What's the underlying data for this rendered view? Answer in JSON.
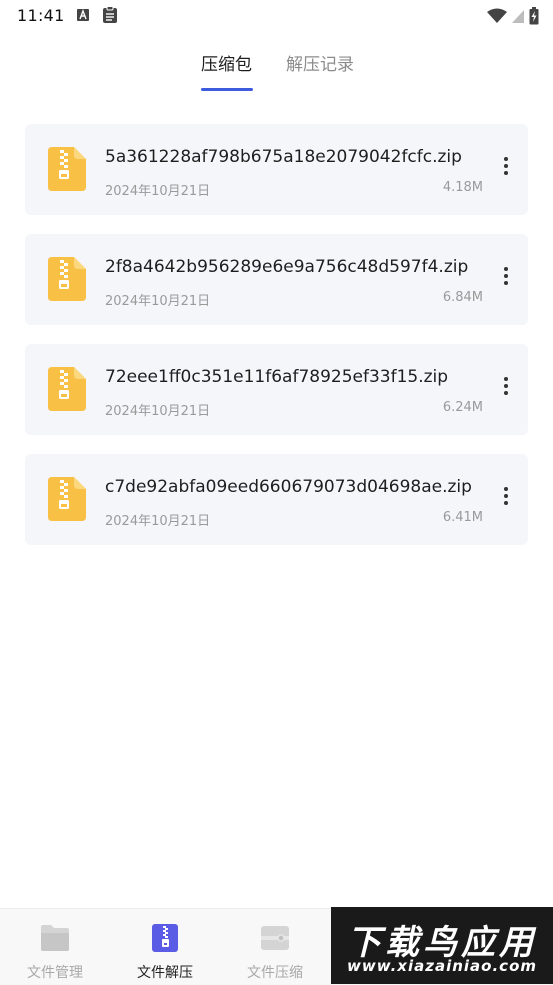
{
  "status_bar": {
    "time": "11:41",
    "left_icons": [
      "a-notification-icon",
      "clipboard-icon"
    ],
    "right_icons": [
      "wifi-icon",
      "signal-icon",
      "battery-charging-icon"
    ]
  },
  "tabs": [
    {
      "label": "压缩包",
      "active": true
    },
    {
      "label": "解压记录",
      "active": false
    }
  ],
  "files": [
    {
      "name": "5a361228af798b675a18e2079042fcfc.zip",
      "date": "2024年10月21日",
      "size": "4.18M"
    },
    {
      "name": "2f8a4642b956289e6e9a756c48d597f4.zip",
      "date": "2024年10月21日",
      "size": "6.84M"
    },
    {
      "name": "72eee1ff0c351e11f6af78925ef33f15.zip",
      "date": "2024年10月21日",
      "size": "6.24M"
    },
    {
      "name": "c7de92abfa09eed660679073d04698ae.zip",
      "date": "2024年10月21日",
      "size": "6.41M"
    }
  ],
  "bottom_nav": [
    {
      "label": "文件管理",
      "icon": "folder-icon",
      "active": false
    },
    {
      "label": "文件解压",
      "icon": "zip-file-icon",
      "active": true
    },
    {
      "label": "文件压缩",
      "icon": "compress-icon",
      "active": false
    }
  ],
  "watermark": {
    "title": "下载鸟应用",
    "url": "www.xiazainiao.com"
  },
  "colors": {
    "accent": "#3d5bdc",
    "zip_icon": "#f9c046",
    "card_bg": "#f5f6fa",
    "nav_active_icon": "#5b5ce6"
  }
}
